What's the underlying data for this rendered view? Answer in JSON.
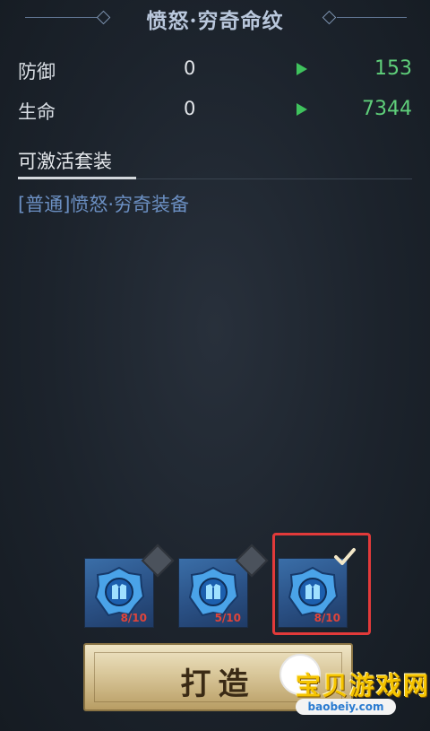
{
  "title": "愤怒·穷奇命纹",
  "stats": [
    {
      "label": "防御",
      "current": "0",
      "new": "153"
    },
    {
      "label": "生命",
      "current": "0",
      "new": "7344"
    }
  ],
  "set_section": {
    "title": "可激活套装",
    "item": "[普通]愤怒·穷奇装备"
  },
  "slots": [
    {
      "count": "8/10",
      "selected": false
    },
    {
      "count": "5/10",
      "selected": false
    },
    {
      "count": "8/10",
      "selected": true
    }
  ],
  "forge_button": {
    "label": "打造"
  },
  "watermark": {
    "text": "宝贝游戏网",
    "url": "baobeiy.com"
  },
  "colors": {
    "increase": "#5fcf7a",
    "set_item": "#6b8fc2",
    "selected_border": "#e23a3a"
  }
}
